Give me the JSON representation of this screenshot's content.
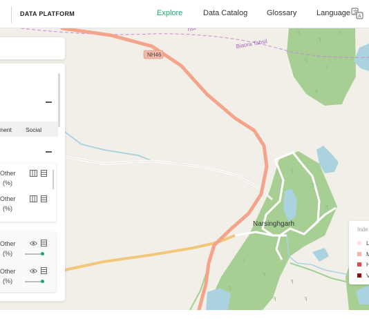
{
  "header": {
    "brand": "DATA PLATFORM",
    "nav": [
      "Explore",
      "Data Catalog",
      "Glossary",
      "Language"
    ],
    "active_nav": "Explore",
    "accent_color": "#1fa86a"
  },
  "map": {
    "labels": {
      "highway": "NH46",
      "district": "Biaora Tahsil",
      "district_fragment": "hsil",
      "town": "Narsinghgarh"
    }
  },
  "side_panel": {
    "tabs": [
      "ment",
      "Social"
    ],
    "layers": [
      {
        "label": "Other",
        "unit": "(%)",
        "icons": [
          "columns-icon",
          "table-icon"
        ]
      },
      {
        "label": "Other",
        "unit": "(%)",
        "icons": [
          "columns-icon",
          "table-icon"
        ]
      }
    ],
    "active_layers": [
      {
        "label": "Other",
        "unit": "(%)",
        "icons": [
          "eye-icon",
          "table-icon"
        ],
        "opacity": 0.85
      },
      {
        "label": "Other",
        "unit": "(%)",
        "icons": [
          "eye-icon",
          "table-icon"
        ],
        "opacity": 0.85
      }
    ]
  },
  "legend": {
    "title": "Inde",
    "items": [
      {
        "label": "L",
        "color": "#fbe3e1"
      },
      {
        "label": "M",
        "color": "#f4b5b0"
      },
      {
        "label": "H",
        "color": "#e0494a"
      },
      {
        "label": "V",
        "color": "#8e0f12"
      }
    ]
  }
}
